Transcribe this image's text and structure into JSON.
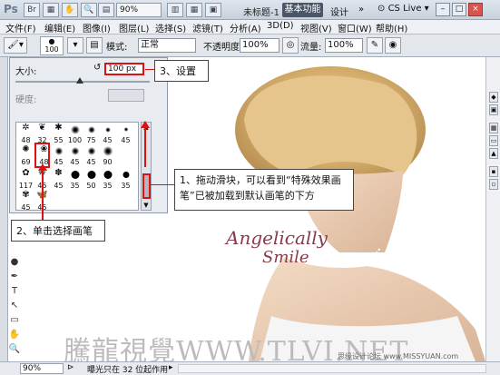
{
  "titlebar": {
    "logo": "Ps",
    "zoom": "90%",
    "document_title": "未标题-1",
    "workspace": "基本功能",
    "design": "设计",
    "more": "»",
    "cs_live": "CS Live",
    "minimize": "–",
    "maximize": "□",
    "close": "×"
  },
  "menu": {
    "items": [
      "文件(F)",
      "编辑(E)",
      "图像(I)",
      "图层(L)",
      "选择(S)",
      "滤镜(T)",
      "分析(A)",
      "3D(D)",
      "视图(V)",
      "窗口(W)",
      "帮助(H)"
    ]
  },
  "options": {
    "brush_size": "100",
    "mode_label": "模式:",
    "mode_value": "正常",
    "opacity_label": "不透明度:",
    "opacity_value": "100%",
    "flow_label": "流量:",
    "flow_value": "100%"
  },
  "brush_panel": {
    "size_label": "大小:",
    "size_value": "100 px",
    "hardness_label": "硬度:",
    "brush_numbers": [
      "48",
      "32",
      "55",
      "100",
      "75",
      "45",
      "69",
      "48",
      "45",
      "45",
      "45",
      "90",
      "117",
      "45",
      "45",
      "35",
      "50",
      "35",
      "45",
      "45",
      "45",
      "35"
    ]
  },
  "annotations": {
    "step3": "3、设置",
    "step1": "1、拖动滑块，可以看到“特殊效果画笔”已被加载到默认画笔的下方",
    "step2": "2、单击选择画笔"
  },
  "canvas": {
    "logo_line1": "Angelically",
    "logo_line2": "Smile"
  },
  "statusbar": {
    "zoom": "90%",
    "message": "曝光只在 32 位起作用"
  },
  "watermark": {
    "main": "騰龍視覺WWW.TLVI.NET",
    "site": "思缘设计论坛 www.MISSYUAN.com"
  }
}
